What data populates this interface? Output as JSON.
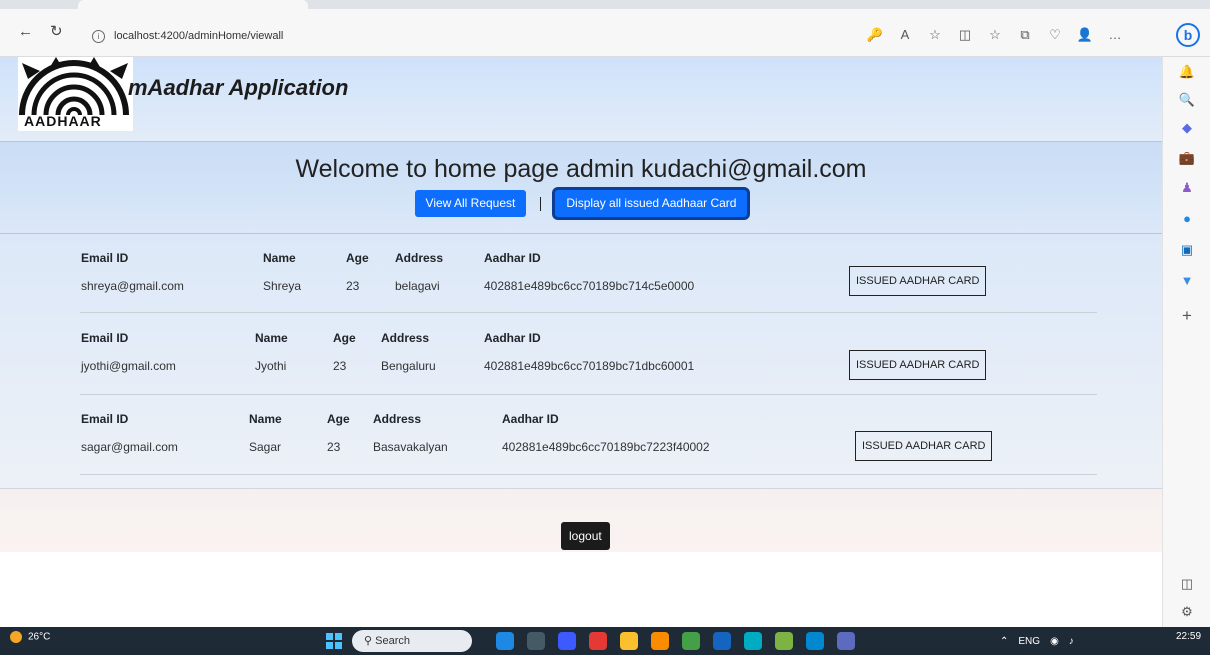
{
  "browser": {
    "back_glyph": "←",
    "refresh_glyph": "↻",
    "url": "localhost:4200/adminHome/viewall",
    "toolbar_icons": [
      "🔑",
      "A",
      "☆",
      "◫",
      "☆",
      "⧉",
      "♡",
      "👤",
      "…"
    ],
    "bing_label": "b"
  },
  "sidebar": {
    "icons": [
      {
        "glyph": "🔔",
        "color": "#2f6fe4"
      },
      {
        "glyph": "🔍",
        "color": "#3a78e6"
      },
      {
        "glyph": "◆",
        "color": "#5b6be6"
      },
      {
        "glyph": "💼",
        "color": "#d9442e"
      },
      {
        "glyph": "♟",
        "color": "#8a5cc9"
      },
      {
        "glyph": "●",
        "color": "#1e88e5"
      },
      {
        "glyph": "▣",
        "color": "#0f6cbd"
      },
      {
        "glyph": "▼",
        "color": "#3b8de0"
      },
      {
        "glyph": "+",
        "color": "#555555"
      }
    ],
    "bottom_icons": [
      "◫",
      "⚙"
    ]
  },
  "header": {
    "logo_text": "AADHAAR",
    "app_title": "mAadhar Application"
  },
  "welcome": {
    "text": "Welcome to home page admin kudachi@gmail.com",
    "view_all_label": "View All Request",
    "display_issued_label": "Display all issued Aadhaar Card"
  },
  "columns": {
    "email": "Email ID",
    "name": "Name",
    "age": "Age",
    "address": "Address",
    "aadhar_id": "Aadhar ID"
  },
  "records": [
    {
      "email": "shreya@gmail.com",
      "name": "Shreya",
      "age": "23",
      "address": "belagavi",
      "aadhar_id": "402881e489bc6cc70189bc714c5e0000",
      "status_label": "ISSUED AADHAR CARD"
    },
    {
      "email": "jyothi@gmail.com",
      "name": "Jyothi",
      "age": "23",
      "address": "Bengaluru",
      "aadhar_id": "402881e489bc6cc70189bc71dbc60001",
      "status_label": "ISSUED AADHAR CARD"
    },
    {
      "email": "sagar@gmail.com",
      "name": "Sagar",
      "age": "23",
      "address": "Basavakalyan",
      "aadhar_id": "402881e489bc6cc70189bc7223f40002",
      "status_label": "ISSUED AADHAR CARD"
    }
  ],
  "footer": {
    "logout_label": "logout"
  },
  "taskbar": {
    "temperature": "26°C",
    "search_placeholder": "Search",
    "language": "ENG",
    "time": "22:59",
    "app_colors": [
      "#1e88e5",
      "#455a64",
      "#3d5afe",
      "#e53935",
      "#fbc02d",
      "#fb8c00",
      "#43a047",
      "#1565c0",
      "#00acc1",
      "#7cb342",
      "#0288d1",
      "#5c6bc0"
    ]
  },
  "colors": {
    "primary_button": "#0d6efd",
    "logout_button": "#1b1b1b"
  }
}
